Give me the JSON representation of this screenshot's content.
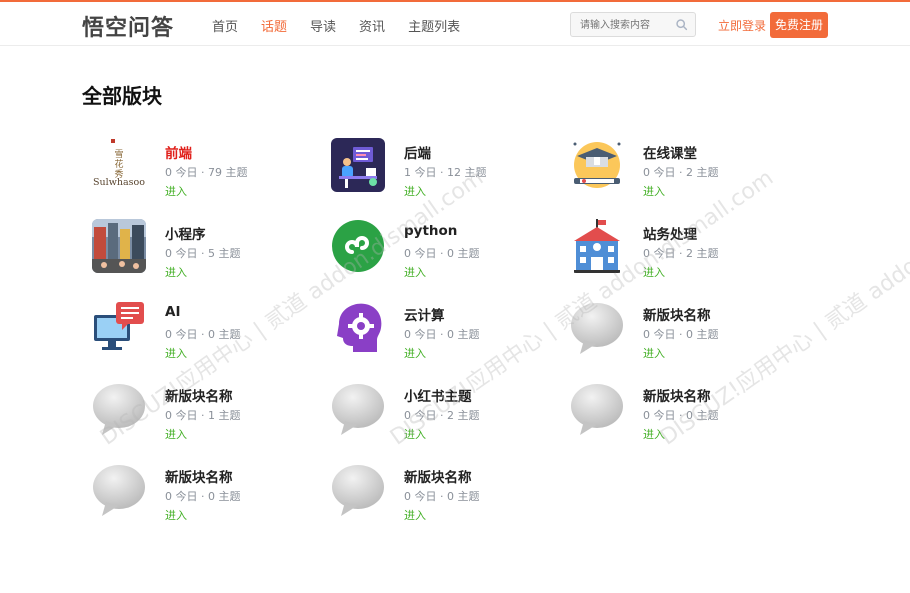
{
  "header": {
    "logo": "悟空问答",
    "nav": [
      {
        "label": "首页",
        "active": false
      },
      {
        "label": "话题",
        "active": true
      },
      {
        "label": "导读",
        "active": false
      },
      {
        "label": "资讯",
        "active": false
      },
      {
        "label": "主题列表",
        "active": false
      }
    ],
    "search_placeholder": "请输入搜索内容",
    "login_label": "立即登录",
    "register_label": "免费注册"
  },
  "page_title": "全部版块",
  "boards": [
    {
      "name": "前端",
      "stats": "0 今日 · 79 主题",
      "enter": "进入",
      "icon": "sulwhasoo-icon",
      "highlight": true,
      "logo_text": "Sulwhasoo"
    },
    {
      "name": "后端",
      "stats": "1 今日 · 12 主题",
      "enter": "进入",
      "icon": "developer-desk-icon"
    },
    {
      "name": "在线课堂",
      "stats": "0 今日 · 2 主题",
      "enter": "进入",
      "icon": "graduation-cap-icon"
    },
    {
      "name": "小程序",
      "stats": "0 今日 · 5 主题",
      "enter": "进入",
      "icon": "street-photo-icon"
    },
    {
      "name": "python",
      "stats": "0 今日 · 0 主题",
      "enter": "进入",
      "icon": "mini-program-icon"
    },
    {
      "name": "站务处理",
      "stats": "0 今日 · 2 主题",
      "enter": "进入",
      "icon": "school-building-icon"
    },
    {
      "name": "AI",
      "stats": "0 今日 · 0 主题",
      "enter": "进入",
      "icon": "monitor-chat-icon"
    },
    {
      "name": "云计算",
      "stats": "0 今日 · 0 主题",
      "enter": "进入",
      "icon": "head-gear-icon"
    },
    {
      "name": "新版块名称",
      "stats": "0 今日 · 0 主题",
      "enter": "进入",
      "icon": "chat-bubble-icon"
    },
    {
      "name": "新版块名称",
      "stats": "0 今日 · 1 主题",
      "enter": "进入",
      "icon": "chat-bubble-icon"
    },
    {
      "name": "小红书主题",
      "stats": "0 今日 · 2 主题",
      "enter": "进入",
      "icon": "chat-bubble-icon"
    },
    {
      "name": "新版块名称",
      "stats": "0 今日 · 0 主题",
      "enter": "进入",
      "icon": "chat-bubble-icon"
    },
    {
      "name": "新版块名称",
      "stats": "0 今日 · 0 主题",
      "enter": "进入",
      "icon": "chat-bubble-icon"
    },
    {
      "name": "新版块名称",
      "stats": "0 今日 · 0 主题",
      "enter": "进入",
      "icon": "chat-bubble-icon"
    }
  ],
  "watermark": "DISCUZ!应用中心 | 贰道 addon.dismall.com",
  "colors": {
    "accent": "#f26b3a",
    "enter": "#44b027",
    "highlight": "#e0201b"
  }
}
